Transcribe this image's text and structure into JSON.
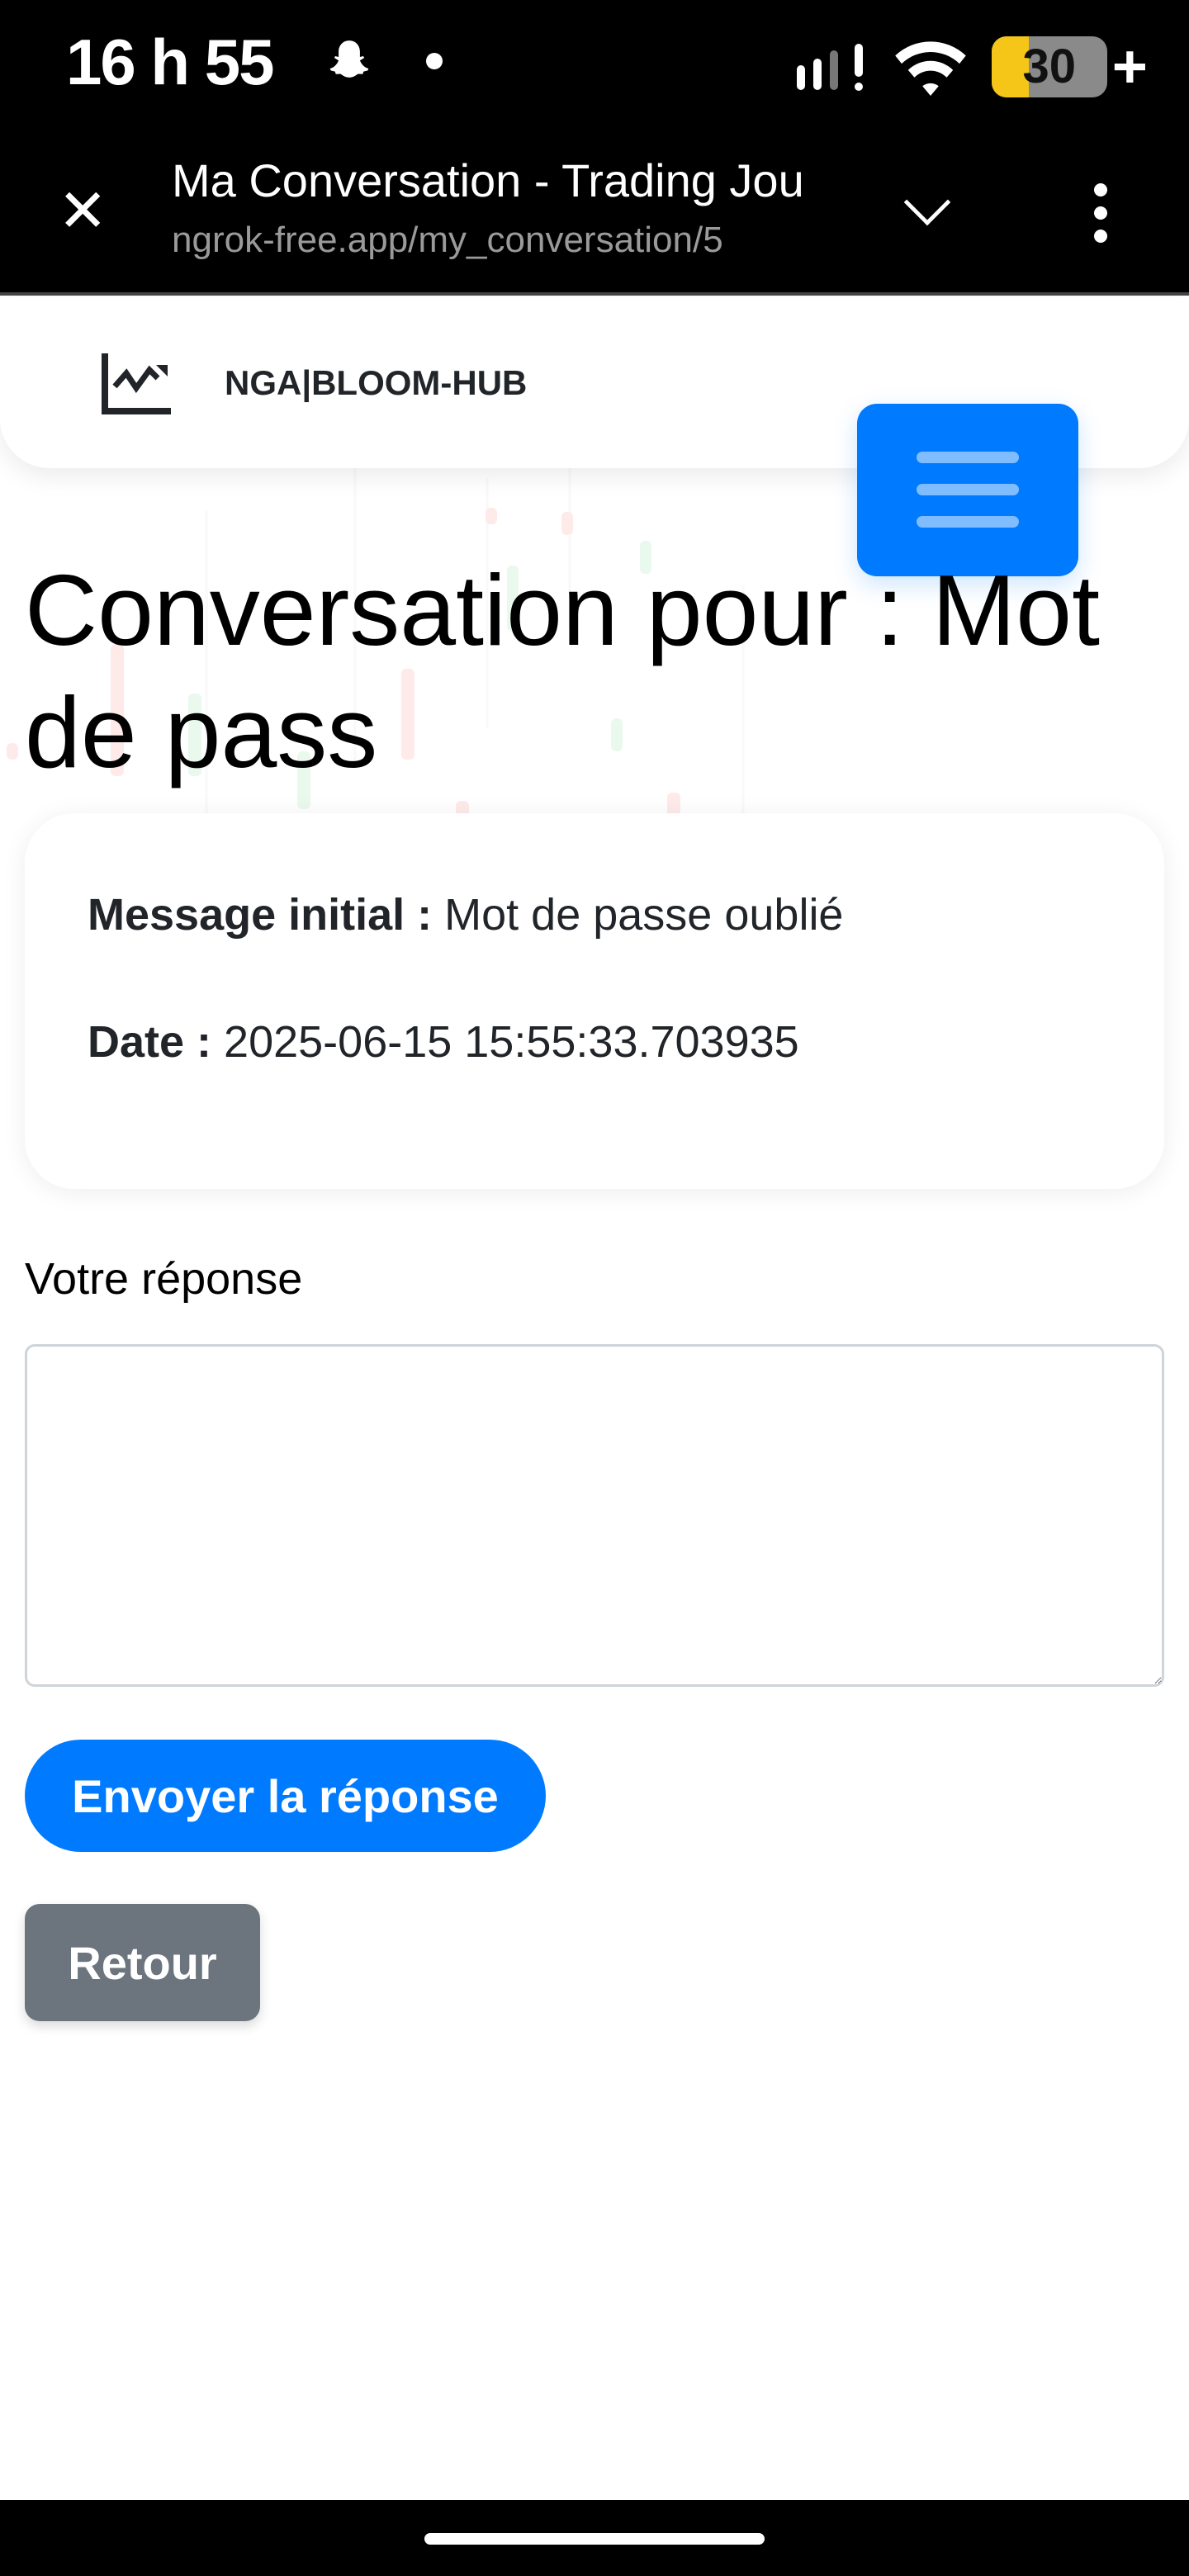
{
  "status_bar": {
    "time": "16 h 55",
    "battery": "30",
    "icons": [
      "snapchat-icon",
      "dot-icon",
      "signal-icon",
      "wifi-icon",
      "battery-icon",
      "charging-plus-icon"
    ]
  },
  "browser": {
    "title": "Ma Conversation - Trading Jou",
    "url": "ngrok-free.app/my_conversation/5"
  },
  "navbar": {
    "brand": "NGA|BLOOM-HUB"
  },
  "page": {
    "title": "Conversation pour : Mot de pass",
    "message_label": "Message initial :",
    "message_value": "Mot de passe oublié",
    "date_label": "Date :",
    "date_value": "2025-06-15 15:55:33.703935",
    "reply_label": "Votre réponse",
    "reply_value": "",
    "send_label": "Envoyer la réponse",
    "back_label": "Retour"
  },
  "colors": {
    "primary": "#007bff",
    "secondary": "#6c757d"
  }
}
